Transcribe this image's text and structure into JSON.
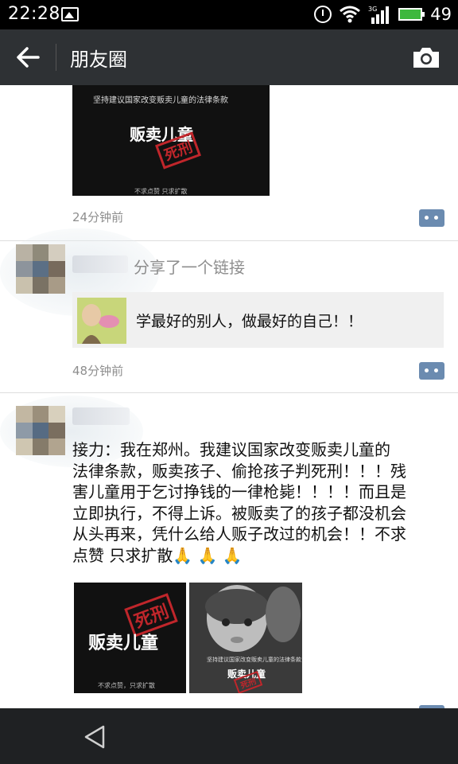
{
  "status_bar": {
    "time": "22:28",
    "battery_level": "49",
    "icons": [
      "image-icon",
      "alarm-icon",
      "wifi-icon",
      "3g-signal-icon",
      "battery-icon"
    ],
    "battery_color": "#3db83d"
  },
  "nav": {
    "title": "朋友圈",
    "back_icon": "back-arrow-icon",
    "camera_icon": "camera-icon",
    "background": "#2e3134"
  },
  "posts": [
    {
      "poster": {
        "caption": "坚持建议国家改变贩卖儿童的法律条款",
        "headline": "贩卖儿童",
        "stamp": "死刑",
        "footer": "不求点赞 只求扩散"
      },
      "time_ago": "24分钟前"
    },
    {
      "action_text": "分享了一个链接",
      "link_title": "学最好的别人，做最好的自己！！",
      "time_ago": "48分钟前"
    },
    {
      "text": "接力：我在郑州。我建议国家改变贩卖儿童的\n法律条款，贩卖孩子、偷抢孩子判死刑！！！残\n害儿童用于乞讨挣钱的一律枪毙！！！！而且是\n立即执行，不得上诉。被贩卖了的孩子都没机会\n从头再来，凭什么给人贩子改过的机会！！不求\n点赞 只求扩散🙏 🙏 🙏",
      "images": [
        {
          "headline": "贩卖儿童",
          "stamp": "死刑",
          "footer": "不求点赞，只求扩散"
        },
        {
          "caption": "坚持建议国家改变贩卖儿童的法律条款",
          "headline": "贩卖儿童",
          "stamp": "死刑"
        }
      ]
    }
  ],
  "colors": {
    "comment_button": "#6b8bb0",
    "time_text": "#8e8e8e",
    "stamp_red": "#c0262b"
  }
}
